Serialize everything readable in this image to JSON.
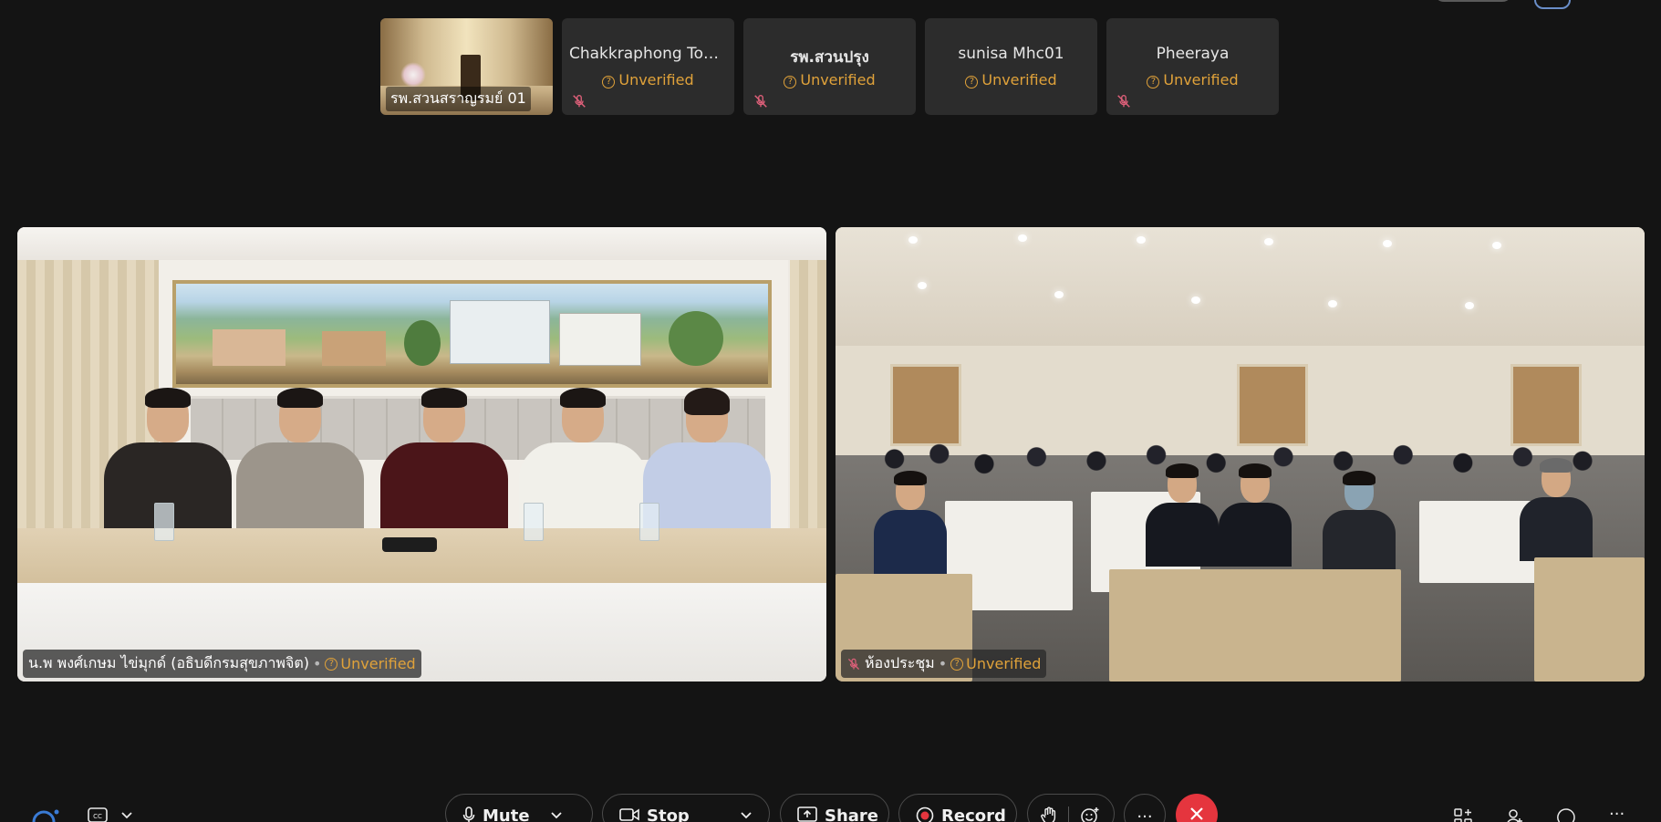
{
  "thumbnails": [
    {
      "type": "video",
      "label": "รพ.สวนสราญรมย์ 01"
    },
    {
      "type": "avatar",
      "name": "Chakkraphong Tomo...",
      "verified_status": "Unverified",
      "muted": true
    },
    {
      "type": "avatar",
      "name": "รพ.สวนปรุง",
      "verified_status": "Unverified",
      "muted": true
    },
    {
      "type": "avatar",
      "name": "sunisa Mhc01",
      "verified_status": "Unverified",
      "muted": false
    },
    {
      "type": "avatar",
      "name": "Pheeraya",
      "verified_status": "Unverified",
      "muted": true
    }
  ],
  "main_videos": {
    "left": {
      "name": "น.พ พงศ์เกษม ไข่มุกด์ (อธิบดีกรมสุขภาพจิต)",
      "separator": "•",
      "verified_status": "Unverified",
      "muted": false
    },
    "right": {
      "name": "ห้องประชุม",
      "separator": "•",
      "verified_status": "Unverified",
      "muted": true
    }
  },
  "toolbar": {
    "mute_label": "Mute",
    "stop_video_label": "Stop video",
    "share_label": "Share",
    "record_label": "Record",
    "more_label": "···",
    "right_more_label": "···"
  },
  "colors": {
    "background": "#141414",
    "unverified": "#e0a23a",
    "end_call": "#e5353e",
    "accent_blue": "#3a7bd5"
  }
}
